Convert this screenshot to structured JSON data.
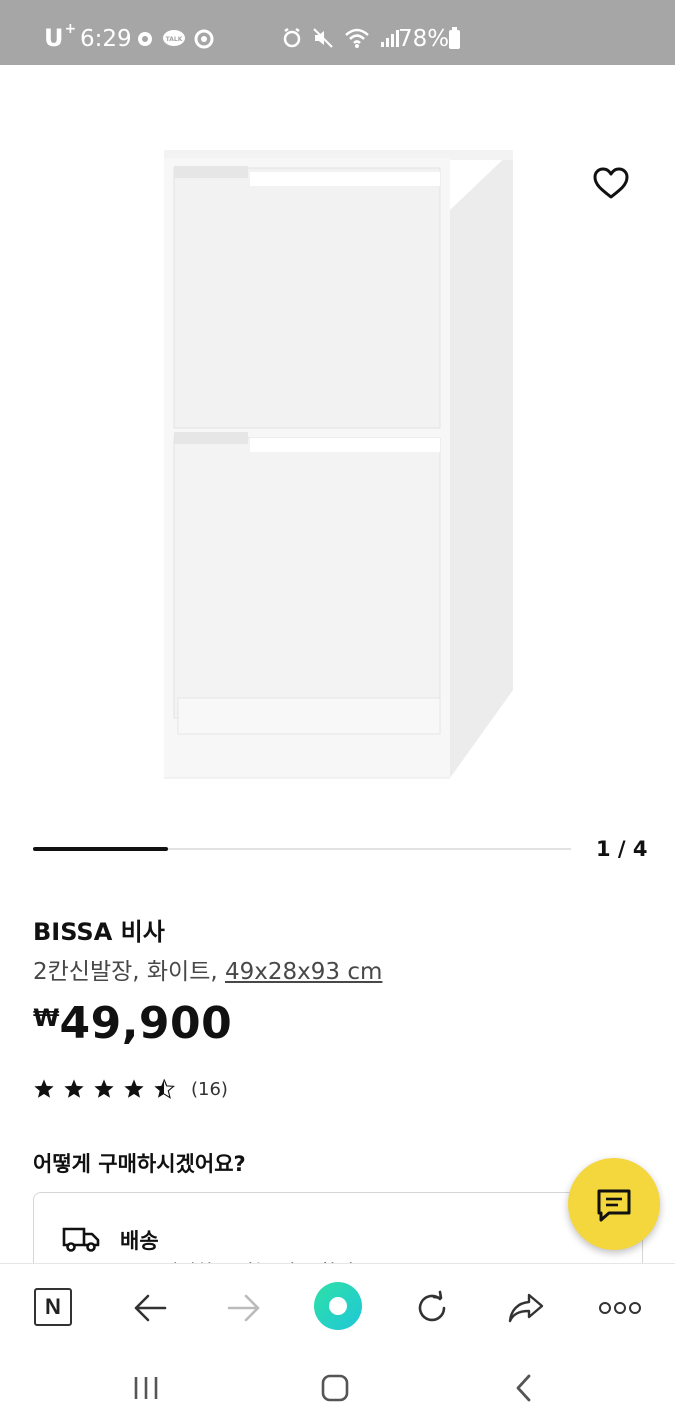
{
  "status_bar": {
    "carrier": "U",
    "carrier_sup": "+",
    "time": "6:29",
    "battery": "78%"
  },
  "gallery": {
    "page_indicator": "1 / 4",
    "progress": 0.25
  },
  "product": {
    "name": "BISSA 비사",
    "description": "2칸신발장, 화이트, ",
    "dimensions": "49x28x93 cm",
    "currency": "₩",
    "price": "49,900",
    "rating": 4.5,
    "review_count": "(16)"
  },
  "purchase": {
    "heading": "어떻게 구매하시겠어요?",
    "delivery_label": "배송",
    "delivery_sub": "주소 입력하고 가능 여부 확인"
  },
  "icons": {
    "favorite": "heart-icon",
    "chat": "chat-icon",
    "delivery": "truck-icon",
    "naver": "N"
  },
  "colors": {
    "status_bar": "#a6a6a6",
    "chat_fab": "#f4d63d",
    "home_button": "#2ee0a6"
  }
}
